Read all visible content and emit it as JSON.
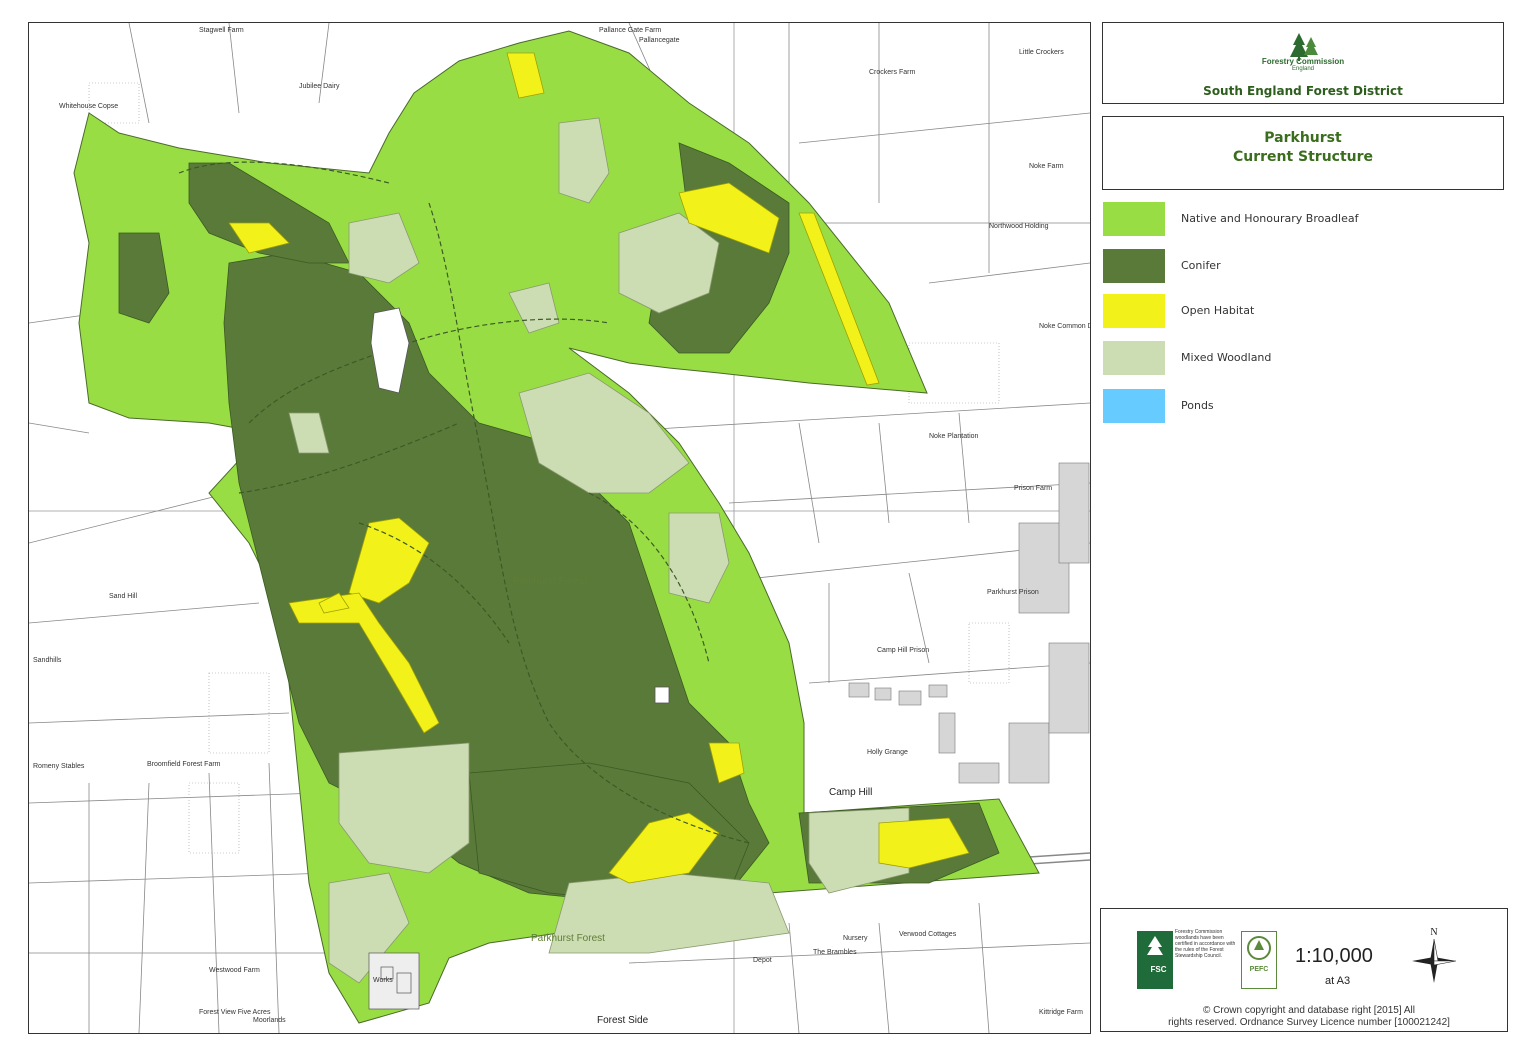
{
  "header": {
    "org_name": "Forestry Commission",
    "org_sub": "England",
    "district": "South England Forest District"
  },
  "title": {
    "line1": "Parkhurst",
    "line2": "Current Structure"
  },
  "legend": [
    {
      "label": "Native and Honourary Broadleaf",
      "color": "#99dd44"
    },
    {
      "label": "Conifer",
      "color": "#5a7a3a"
    },
    {
      "label": "Open Habitat",
      "color": "#f2f21a"
    },
    {
      "label": "Mixed Woodland",
      "color": "#ccdcb3"
    },
    {
      "label": "Ponds",
      "color": "#66ccff"
    }
  ],
  "footer": {
    "fsc_text": "FSC",
    "fsc_note": "Forestry Commission woodlands have been certified in accordance with the rules of the Forest Stewardship Council.",
    "pefc_text": "PEFC",
    "scale": "1:10,000",
    "scale_note": "at A3",
    "north_label": "N",
    "copyright_line1": "© Crown copyright and database right [2015] All",
    "copyright_line2": "rights reserved. Ordnance Survey Licence number [100021242]"
  },
  "map_labels": {
    "stagwell": "Stagwell Farm",
    "pallance": "Pallance Gate Farm",
    "pallancegate": "Pallancegate",
    "jubilee": "Jubilee Dairy",
    "whitehouse": "Whitehouse Copse",
    "crockers": "Crockers Farm",
    "little_crockers": "Little Crockers",
    "noke_farm": "Noke Farm",
    "northwood": "Northwood Holding",
    "noke_common": "Noke Common Dairy",
    "noke_plantation": "Noke Plantation",
    "prison_farm": "Prison Farm",
    "parkhurst_prison": "Parkhurst Prison",
    "camp_hill_prison": "Camp Hill Prison",
    "camp_hill": "Camp Hill",
    "sand_hill": "Sand Hill",
    "sandhills": "Sandhills",
    "romeny": "Romeny Stables",
    "broomfield": "Broomfield Forest Farm",
    "westwood": "Westwood Farm",
    "forest_view": "Forest View Five Acres",
    "moorlands": "Moorlands",
    "forest_side": "Forest Side",
    "parkhurst_forest_1": "Parkhurst Forest",
    "parkhurst_forest_2": "Parkhurst Forest",
    "nursery": "Nursery",
    "verwood": "Verwood Cottages",
    "depot": "Depot",
    "brambles": "The Brambles",
    "kittridge": "Kittridge Farm",
    "holly_grange": "Holly Grange",
    "works": "Works"
  }
}
